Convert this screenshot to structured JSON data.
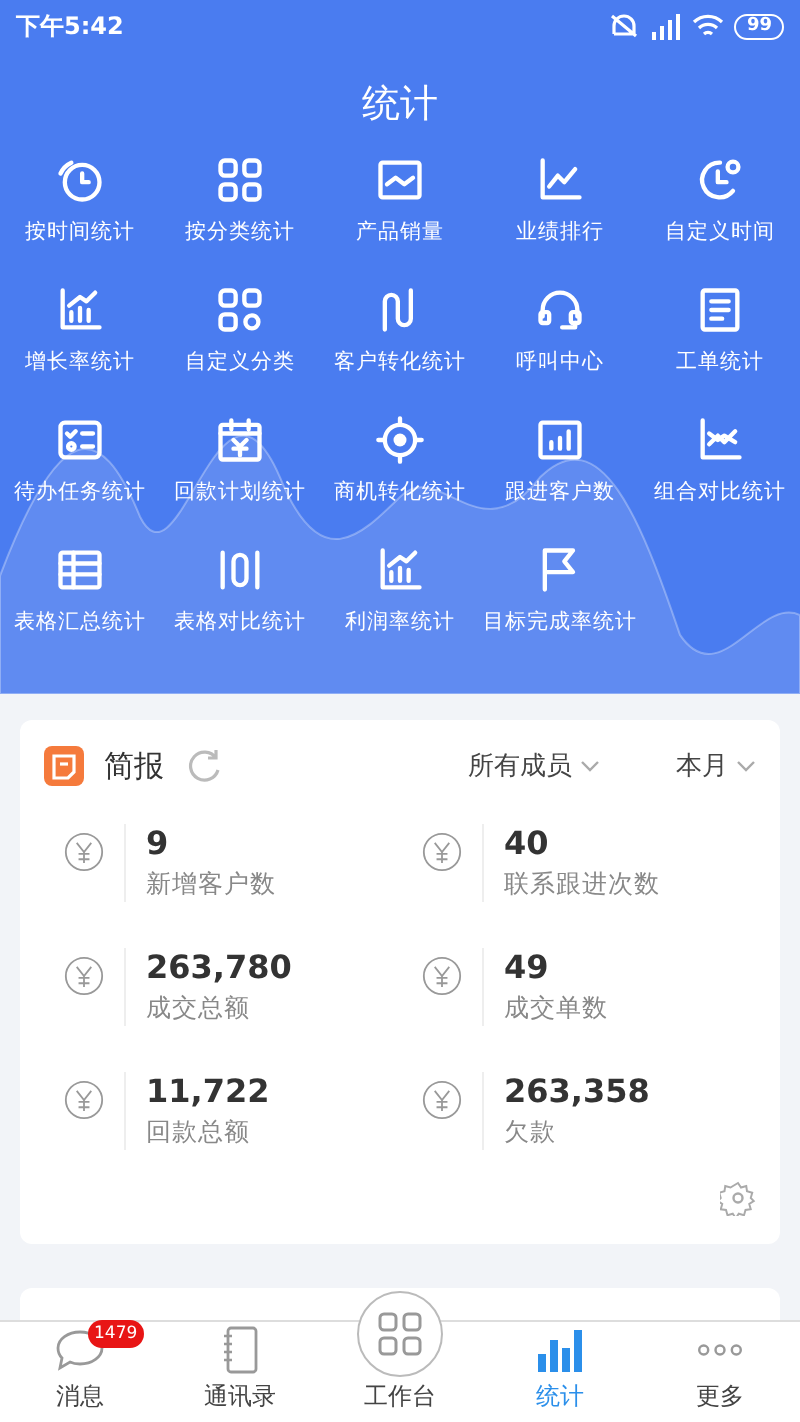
{
  "status_bar": {
    "time": "下午5:42",
    "battery": "99"
  },
  "title": "统计",
  "shortcuts": [
    {
      "label": "按时间统计"
    },
    {
      "label": "按分类统计"
    },
    {
      "label": "产品销量"
    },
    {
      "label": "业绩排行"
    },
    {
      "label": "自定义时间"
    },
    {
      "label": "增长率统计"
    },
    {
      "label": "自定义分类"
    },
    {
      "label": "客户转化统计"
    },
    {
      "label": "呼叫中心"
    },
    {
      "label": "工单统计"
    },
    {
      "label": "待办任务统计"
    },
    {
      "label": "回款计划统计"
    },
    {
      "label": "商机转化统计"
    },
    {
      "label": "跟进客户数"
    },
    {
      "label": "组合对比统计"
    },
    {
      "label": "表格汇总统计"
    },
    {
      "label": "表格对比统计"
    },
    {
      "label": "利润率统计"
    },
    {
      "label": "目标完成率统计"
    }
  ],
  "summary": {
    "title": "简报",
    "member_filter": "所有成员",
    "period_filter": "本月",
    "metrics": [
      {
        "value": "9",
        "label": "新增客户数"
      },
      {
        "value": "40",
        "label": "联系跟进次数"
      },
      {
        "value": "263,780",
        "label": "成交总额"
      },
      {
        "value": "49",
        "label": "成交单数"
      },
      {
        "value": "11,722",
        "label": "回款总额"
      },
      {
        "value": "263,358",
        "label": "欠款"
      }
    ]
  },
  "tab_bar": [
    {
      "label": "消息",
      "kind": "normal",
      "badge": "1479",
      "selected": false
    },
    {
      "label": "通讯录",
      "kind": "normal",
      "selected": false
    },
    {
      "label": "工作台",
      "kind": "center",
      "selected": false
    },
    {
      "label": "统计",
      "kind": "normal",
      "selected": true
    },
    {
      "label": "更多",
      "kind": "normal",
      "selected": false
    }
  ]
}
